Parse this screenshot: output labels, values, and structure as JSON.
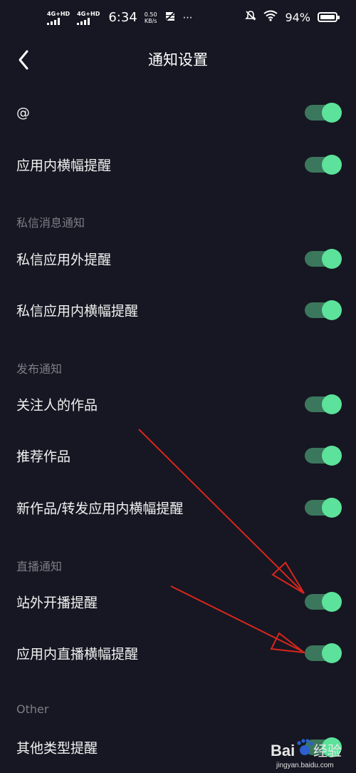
{
  "status_bar": {
    "network_1": "4G+HD",
    "network_2": "4G+HD",
    "time": "6:34",
    "speed_value": "0.50",
    "speed_unit": "KB/s",
    "battery": "94%"
  },
  "header": {
    "title": "通知设置"
  },
  "items": {
    "at": {
      "label": "@",
      "enabled": true
    },
    "in_app_banner": {
      "label": "应用内横幅提醒",
      "enabled": true
    },
    "dm_out_app": {
      "label": "私信应用外提醒",
      "enabled": true
    },
    "dm_in_app_banner": {
      "label": "私信应用内横幅提醒",
      "enabled": true
    },
    "followed_works": {
      "label": "关注人的作品",
      "enabled": true
    },
    "recommended_works": {
      "label": "推荐作品",
      "enabled": true
    },
    "new_repost_banner": {
      "label": "新作品/转发应用内横幅提醒",
      "enabled": true
    },
    "live_out_site": {
      "label": "站外开播提醒",
      "enabled": true
    },
    "live_in_app_banner": {
      "label": "应用内直播横幅提醒",
      "enabled": true
    },
    "other_types": {
      "label": "其他类型提醒",
      "enabled": true
    }
  },
  "sections": {
    "dm": "私信消息通知",
    "publish": "发布通知",
    "live": "直播通知",
    "other": "Other"
  },
  "watermark": {
    "brand_text": "Bai",
    "brand_text_2": "经验",
    "url": "jingyan.baidu.com"
  },
  "colors": {
    "background": "#161722",
    "toggle_track": "#3b775c",
    "toggle_knob": "#5ce29a",
    "section_text": "#7c7e86",
    "annotation_arrow": "#d8261d"
  }
}
